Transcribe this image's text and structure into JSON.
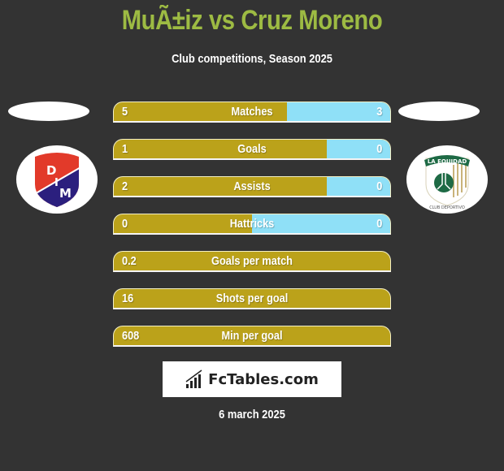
{
  "header": {
    "title": "MuÃ±iz vs Cruz Moreno",
    "subtitle": "Club competitions, Season 2025"
  },
  "players": {
    "left": {
      "club_logo": "independiente-medellin-crest",
      "crest_letters": [
        "D",
        "I",
        "M"
      ]
    },
    "right": {
      "club_logo": "la-equidad-crest",
      "crest_text_top": "LA EQUIDAD",
      "crest_text_bottom": "CLUB DEPORTIVO"
    }
  },
  "colors": {
    "title": "#9dbb43",
    "left_bar": "#bba21a",
    "right_bar": "#8fe0f7",
    "background": "#333333"
  },
  "stats": [
    {
      "label": "Matches",
      "left": "5",
      "right": "3",
      "left_share": 0.625
    },
    {
      "label": "Goals",
      "left": "1",
      "right": "0",
      "left_share": 0.77
    },
    {
      "label": "Assists",
      "left": "2",
      "right": "0",
      "left_share": 0.77
    },
    {
      "label": "Hattricks",
      "left": "0",
      "right": "0",
      "left_share": 0.5
    },
    {
      "label": "Goals per match",
      "left": "0.2",
      "right": "",
      "left_share": 1.0
    },
    {
      "label": "Shots per goal",
      "left": "16",
      "right": "",
      "left_share": 1.0
    },
    {
      "label": "Min per goal",
      "left": "608",
      "right": "",
      "left_share": 1.0
    }
  ],
  "footer": {
    "brand": "FcTables.com",
    "brand_icon": "bar-chart-icon",
    "date": "6 march 2025"
  }
}
